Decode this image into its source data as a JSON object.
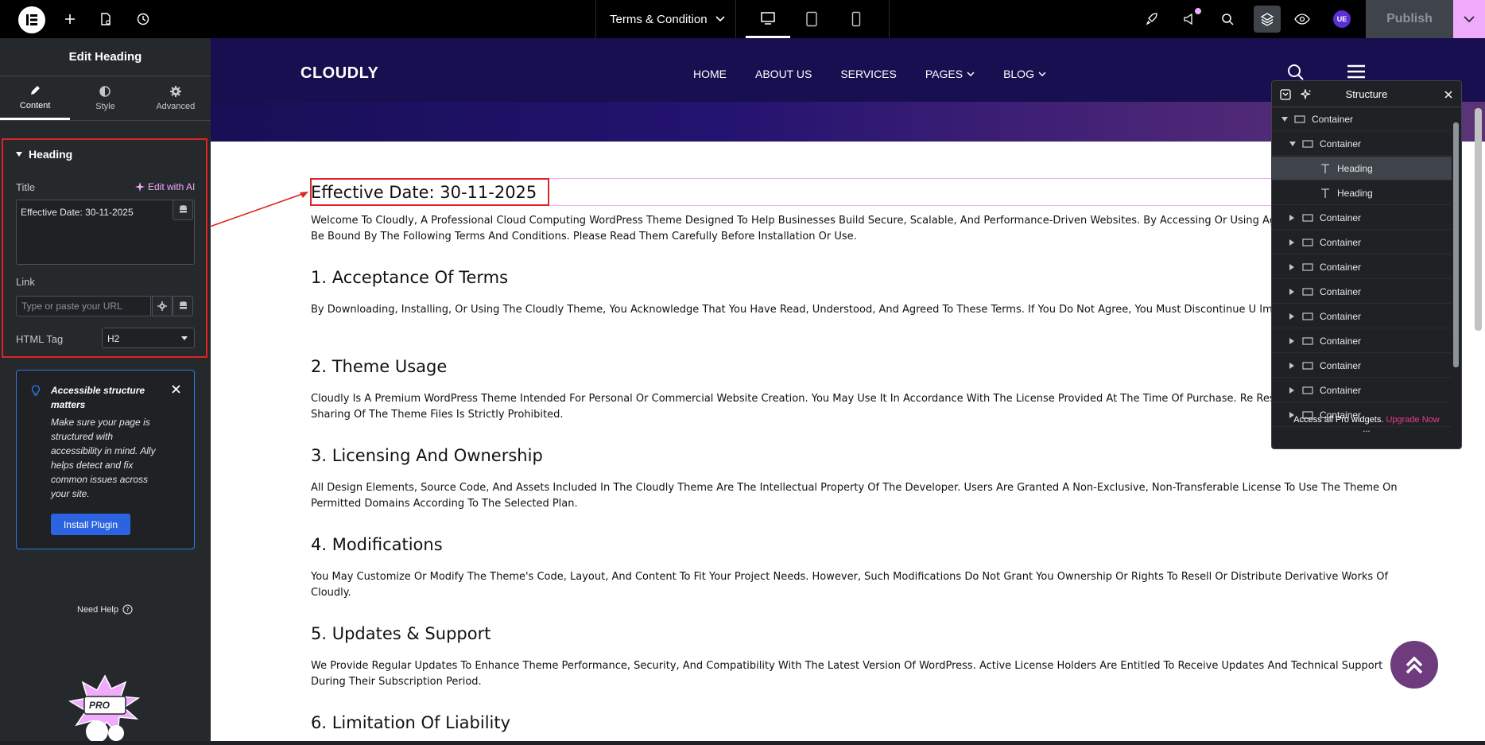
{
  "topbar": {
    "page_title": "Terms & Condition",
    "publish_label": "Publish",
    "avatar_text": "UE"
  },
  "panel": {
    "header": "Edit Heading",
    "tabs": [
      {
        "label": "Content"
      },
      {
        "label": "Style"
      },
      {
        "label": "Advanced"
      }
    ],
    "section_title": "Heading",
    "title_label": "Title",
    "edit_ai": "Edit with AI",
    "title_value": "Effective Date: 30-11-2025",
    "link_label": "Link",
    "link_placeholder": "Type or paste your URL",
    "html_tag_label": "HTML Tag",
    "html_tag_value": "H2",
    "notice_title": "Accessible structure matters",
    "notice_body": "Make sure your page is structured with accessibility in mind. Ally helps detect and fix common issues across your site.",
    "install_label": "Install Plugin",
    "need_help": "Need Help",
    "promo_badge": "PRO"
  },
  "site": {
    "brand": "CLOUDLY",
    "menu": [
      "HOME",
      "ABOUT US",
      "SERVICES",
      "PAGES",
      "BLOG"
    ],
    "sections": [
      {
        "heading": "Effective Date: 30-11-2025",
        "text": "Welcome To Cloudly, A Professional Cloud Computing WordPress Theme Designed To Help Businesses Build Secure, Scalable, And Performance-Driven Websites. By Accessing Or Using Agree To Comply With And Be Bound By The Following Terms And Conditions. Please Read Them Carefully Before Installation Or Use."
      },
      {
        "heading": "1. Acceptance Of Terms",
        "text": "By Downloading, Installing, Or Using The Cloudly Theme, You Acknowledge That You Have Read, Understood, And Agreed To These Terms. If You Do Not Agree, You Must Discontinue U Immediately."
      },
      {
        "heading": "2. Theme Usage",
        "text": "Cloudly Is A Premium WordPress Theme Intended For Personal Or Commercial Website Creation. You May Use It In Accordance With The License Provided At The Time Of Purchase. Re Resale, Or Unauthorized Sharing Of The Theme Files Is Strictly Prohibited."
      },
      {
        "heading": "3. Licensing And Ownership",
        "text": "All Design Elements, Source Code, And Assets Included In The Cloudly Theme Are The Intellectual Property Of The Developer. Users Are Granted A Non-Exclusive, Non-Transferable License To Use The Theme On Permitted Domains According To The Selected Plan."
      },
      {
        "heading": "4. Modifications",
        "text": "You May Customize Or Modify The Theme's Code, Layout, And Content To Fit Your Project Needs. However, Such Modifications Do Not Grant You Ownership Or Rights To Resell Or Distribute Derivative Works Of Cloudly."
      },
      {
        "heading": "5. Updates & Support",
        "text": "We Provide Regular Updates To Enhance Theme Performance, Security, And Compatibility With The Latest Version Of WordPress. Active License Holders Are Entitled To Receive Updates And Technical Support During Their Subscription Period."
      },
      {
        "heading": "6. Limitation Of Liability",
        "text": ""
      }
    ]
  },
  "structure": {
    "title": "Structure",
    "items": [
      {
        "label": "Container",
        "level": 0,
        "expanded": true
      },
      {
        "label": "Container",
        "level": 1,
        "expanded": true
      },
      {
        "label": "Heading",
        "level": 2,
        "type": "heading",
        "active": true
      },
      {
        "label": "Heading",
        "level": 2,
        "type": "heading"
      },
      {
        "label": "Container",
        "level": 1
      },
      {
        "label": "Container",
        "level": 1
      },
      {
        "label": "Container",
        "level": 1
      },
      {
        "label": "Container",
        "level": 1
      },
      {
        "label": "Container",
        "level": 1
      },
      {
        "label": "Container",
        "level": 1
      },
      {
        "label": "Container",
        "level": 1
      },
      {
        "label": "Container",
        "level": 1
      },
      {
        "label": "Container",
        "level": 1
      }
    ],
    "footer_text": "Access all Pro widgets.",
    "footer_link": "Upgrade Now",
    "more": "..."
  }
}
